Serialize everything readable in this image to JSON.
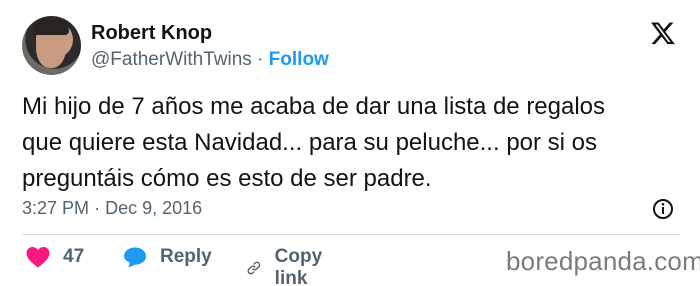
{
  "author": {
    "name": "Robert Knop",
    "handle": "@FatherWithTwins",
    "separator": "·",
    "follow_label": "Follow"
  },
  "tweet": {
    "line1": "Mi hijo de 7 años me acaba de dar una lista de regalos",
    "line2": "que quiere esta Navidad... para su peluche... por si os",
    "line3": "preguntáis cómo es esto de ser padre.",
    "time": "3:27 PM",
    "date_separator": "·",
    "date": "Dec 9, 2016"
  },
  "actions": {
    "like_count": "47",
    "reply_label": "Reply",
    "copy_label": "Copy link"
  },
  "watermark": "boredpanda.com",
  "colors": {
    "like": "#f91880",
    "reply": "#1d9bf0",
    "follow": "#1d9bf0",
    "muted": "#536471"
  },
  "icons": [
    "x-logo-icon",
    "info-icon",
    "heart-icon",
    "reply-bubble-icon",
    "link-icon"
  ]
}
